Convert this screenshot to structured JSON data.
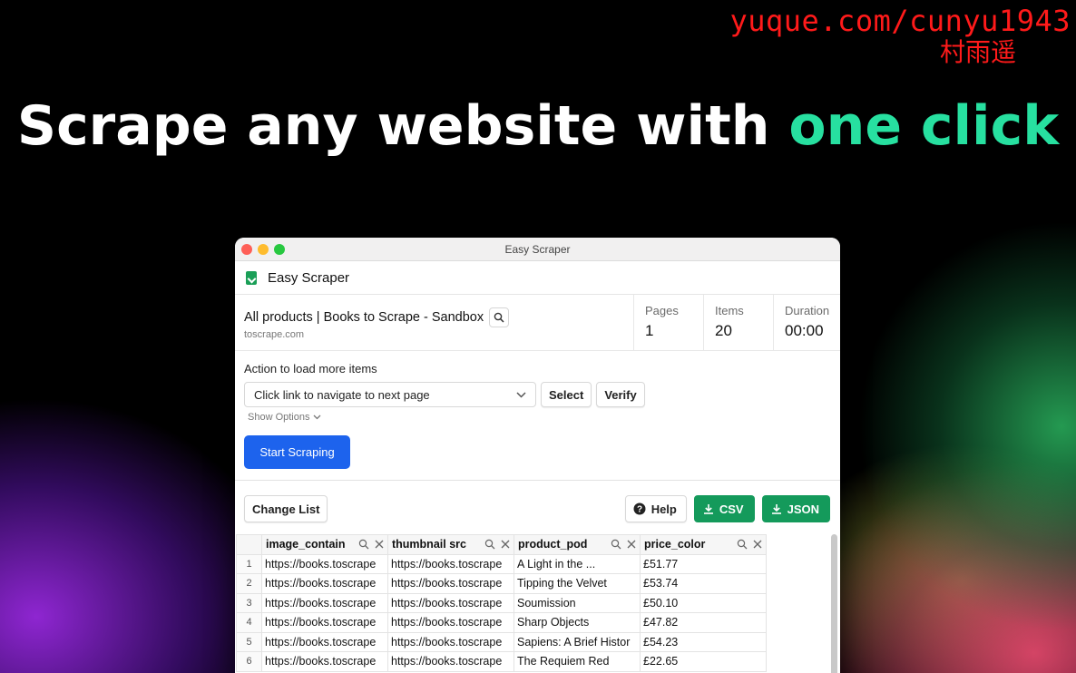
{
  "watermark": {
    "line1": "yuque.com/cunyu1943",
    "line2": "村雨遥"
  },
  "headline": {
    "main": "Scrape any website with ",
    "highlight": "one click"
  },
  "window": {
    "title": "Easy Scraper",
    "app_name": "Easy Scraper",
    "page": {
      "title": "All products | Books to Scrape - Sandbox",
      "domain": "toscrape.com"
    },
    "stats": [
      {
        "label": "Pages",
        "value": "1"
      },
      {
        "label": "Items",
        "value": "20"
      },
      {
        "label": "Duration",
        "value": "00:00"
      }
    ],
    "action": {
      "label": "Action to load more items",
      "selected": "Click link to navigate to next page",
      "select_label": "Select",
      "verify_label": "Verify",
      "show_options": "Show Options",
      "start_label": "Start Scraping"
    },
    "list": {
      "change_list": "Change List",
      "help": "Help",
      "csv": "CSV",
      "json": "JSON",
      "columns": [
        "image_contain",
        "thumbnail src",
        "product_pod",
        "price_color"
      ],
      "rows": [
        [
          "https://books.toscrape",
          "https://books.toscrape",
          "A Light in the ...",
          "£51.77"
        ],
        [
          "https://books.toscrape",
          "https://books.toscrape",
          "Tipping the Velvet",
          "£53.74"
        ],
        [
          "https://books.toscrape",
          "https://books.toscrape",
          "Soumission",
          "£50.10"
        ],
        [
          "https://books.toscrape",
          "https://books.toscrape",
          "Sharp Objects",
          "£47.82"
        ],
        [
          "https://books.toscrape",
          "https://books.toscrape",
          "Sapiens: A Brief Histor",
          "£54.23"
        ],
        [
          "https://books.toscrape",
          "https://books.toscrape",
          "The Requiem Red",
          "£22.65"
        ]
      ]
    }
  },
  "colors": {
    "accent_blue": "#1d63ed",
    "green": "#149a5b",
    "headline_highlight": "#27e0a0",
    "watermark": "#ff1a1a"
  }
}
